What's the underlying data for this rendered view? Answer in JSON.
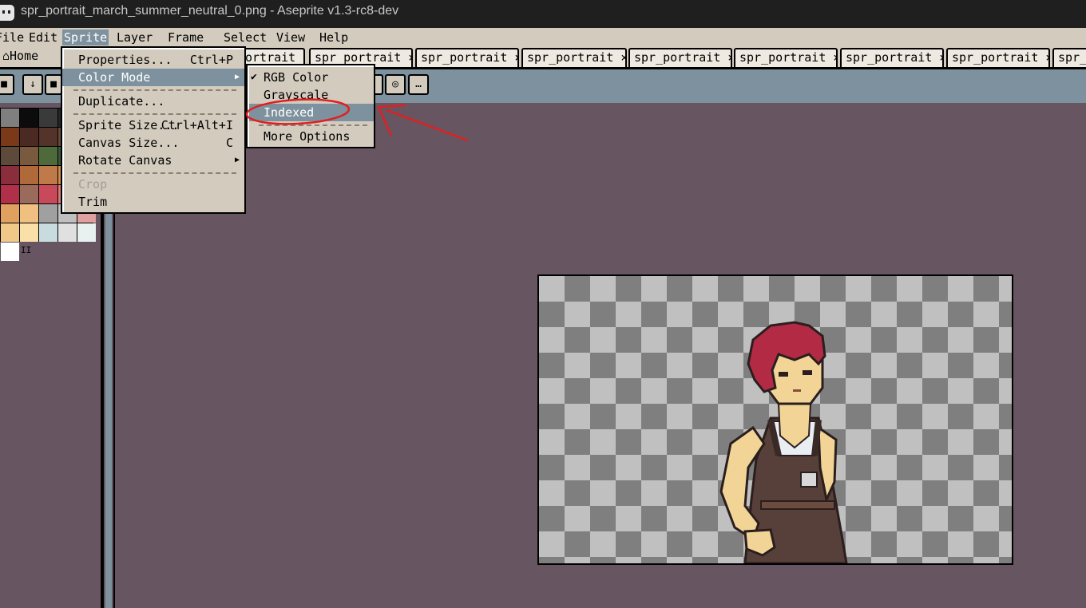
{
  "window": {
    "title": "spr_portrait_march_summer_neutral_0.png - Aseprite v1.3-rc8-dev"
  },
  "menubar": {
    "items": [
      "File",
      "Edit",
      "Sprite",
      "Layer",
      "Frame",
      "Select",
      "View",
      "Help"
    ],
    "active": "Sprite"
  },
  "tabs": {
    "home": "Home",
    "open": [
      "ortrait",
      "spr_portrait",
      "spr_portrait",
      "spr_portrait",
      "spr_portrait",
      "spr_portrait",
      "spr_portrait",
      "spr_portrait",
      "spr_"
    ],
    "close_glyph": "×"
  },
  "sprite_menu": {
    "properties": {
      "label": "Properties...",
      "shortcut": "Ctrl+P"
    },
    "color_mode": {
      "label": "Color Mode"
    },
    "duplicate": {
      "label": "Duplicate..."
    },
    "sprite_size": {
      "label": "Sprite Size...",
      "shortcut": "Ctrl+Alt+I"
    },
    "canvas_size": {
      "label": "Canvas Size...",
      "shortcut": "C"
    },
    "rotate_canvas": {
      "label": "Rotate Canvas"
    },
    "crop": {
      "label": "Crop"
    },
    "trim": {
      "label": "Trim"
    }
  },
  "color_mode_menu": {
    "rgb": {
      "label": "RGB Color",
      "checked": true
    },
    "grayscale": {
      "label": "Grayscale"
    },
    "indexed": {
      "label": "Indexed"
    },
    "more": {
      "label": "More Options"
    }
  },
  "palette": {
    "colors": [
      "#7f7f7f",
      "#0c0c0c",
      "#3a3a3a",
      "#262626",
      "#585858",
      "#7a3a1a",
      "#4a2a22",
      "#53332a",
      "#6a4a3a",
      "#4e4a4a",
      "#5e4a3a",
      "#7a5a3e",
      "#4e6a3a",
      "#3a5a3a",
      "#6a6a5a",
      "#8a2e3e",
      "#b06a3a",
      "#c07a4a",
      "#d08a4a",
      "#eeeeee",
      "#b0304a",
      "#9a6a5a",
      "#c84a5a",
      "#e07a7a",
      "#c08a7a",
      "#e0a060",
      "#f0c080",
      "#a0a0a0",
      "#c0c0c0",
      "#e0a0a0",
      "#f0c88a",
      "#f8e0a8",
      "#c8dce0",
      "#e0e0e0",
      "#e8f0f0",
      "#ffffff"
    ],
    "index_label": "II"
  },
  "annotation": {
    "color": "#e02020"
  }
}
